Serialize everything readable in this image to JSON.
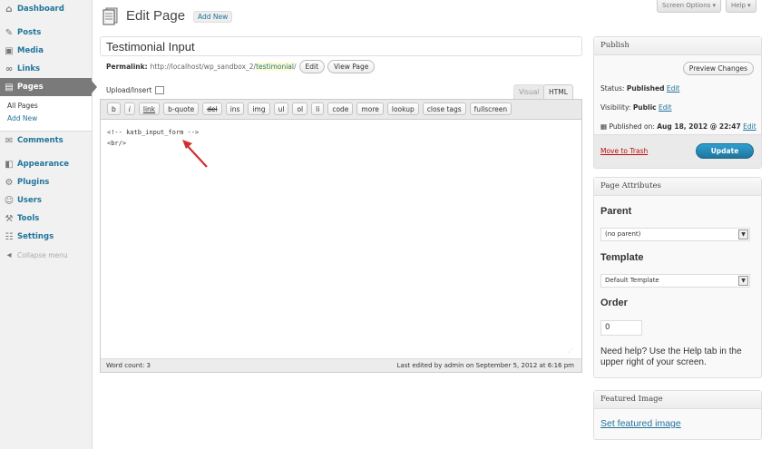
{
  "sidebar": {
    "items": [
      {
        "label": "Dashboard",
        "icon": "dashboard-icon",
        "glyph": "⌂"
      },
      {
        "label": "Posts",
        "icon": "pin-icon",
        "glyph": "✎"
      },
      {
        "label": "Media",
        "icon": "media-icon",
        "glyph": "▣"
      },
      {
        "label": "Links",
        "icon": "link-icon",
        "glyph": "∞"
      },
      {
        "label": "Pages",
        "icon": "pages-icon",
        "glyph": "▤"
      },
      {
        "label": "Comments",
        "icon": "comment-icon",
        "glyph": "✉"
      },
      {
        "label": "Appearance",
        "icon": "appearance-icon",
        "glyph": "◧"
      },
      {
        "label": "Plugins",
        "icon": "plugin-icon",
        "glyph": "⚙"
      },
      {
        "label": "Users",
        "icon": "users-icon",
        "glyph": "☺"
      },
      {
        "label": "Tools",
        "icon": "tools-icon",
        "glyph": "⚒"
      },
      {
        "label": "Settings",
        "icon": "settings-icon",
        "glyph": "☷"
      }
    ],
    "pages_submenu": [
      "All Pages",
      "Add New"
    ],
    "collapse_label": "Collapse menu"
  },
  "topbar": {
    "screen_options": "Screen Options ▾",
    "help": "Help ▾"
  },
  "header": {
    "title": "Edit Page",
    "add_new": "Add New"
  },
  "post": {
    "title": "Testimonial Input",
    "permalink_label": "Permalink:",
    "permalink_base": "http://localhost/wp_sandbox_2/",
    "permalink_slug": "testimonial",
    "permalink_end": "/",
    "edit_btn": "Edit",
    "view_btn": "View Page"
  },
  "editor": {
    "upload_label": "Upload/Insert",
    "tab_visual": "Visual",
    "tab_html": "HTML",
    "quicktags": [
      "b",
      "i",
      "link",
      "b-quote",
      "del",
      "ins",
      "img",
      "ul",
      "ol",
      "li",
      "code",
      "more",
      "lookup",
      "close tags",
      "fullscreen"
    ],
    "content": "<!-- katb_input_form -->\n<br/>",
    "word_count": "Word count: 3",
    "last_edited": "Last edited by admin on September 5, 2012 at 6:16 pm"
  },
  "publish": {
    "title": "Publish",
    "preview_btn": "Preview Changes",
    "status_label": "Status:",
    "status_value": "Published",
    "visibility_label": "Visibility:",
    "visibility_value": "Public",
    "published_on_label": "Published on:",
    "published_on_value": "Aug 18, 2012 @ 22:47",
    "edit_link": "Edit",
    "trash": "Move to Trash",
    "update": "Update"
  },
  "attributes": {
    "title": "Page Attributes",
    "parent_heading": "Parent",
    "parent_value": "(no parent)",
    "template_heading": "Template",
    "template_value": "Default Template",
    "order_heading": "Order",
    "order_value": "0",
    "help_text": "Need help? Use the Help tab in the upper right of your screen."
  },
  "featured": {
    "title": "Featured Image",
    "link": "Set featured image"
  },
  "colors": {
    "link": "#21759b",
    "annotation_arrow": "#d12f2f",
    "update_button": "#21759b"
  }
}
